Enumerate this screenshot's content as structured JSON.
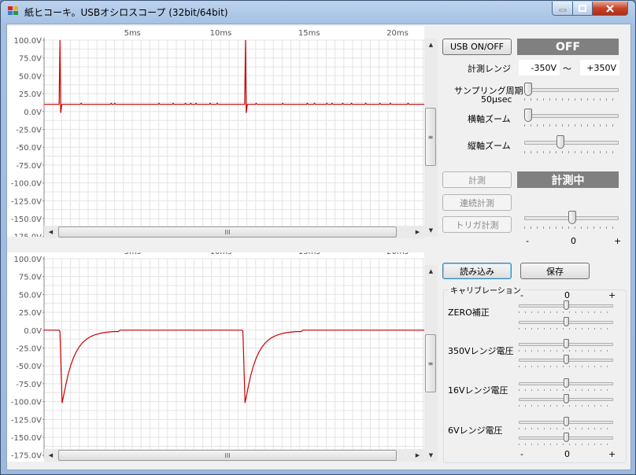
{
  "window": {
    "title": "紙ヒコーキ。USBオシロスコープ (32bit/64bit)"
  },
  "plot": {
    "y_ticks": [
      "100.0V",
      "75.0V",
      "50.0V",
      "25.0V",
      "0.0V",
      "-25.0V",
      "-50.0V",
      "-75.0V",
      "-100.0V",
      "-125.0V",
      "-150.0V",
      "-175.0V"
    ],
    "x_ticks": [
      "5ms",
      "10ms",
      "15ms",
      "20ms"
    ],
    "line_color": "#cc0000"
  },
  "chart_data": [
    {
      "type": "line",
      "x_ticks": [
        "5ms",
        "10ms",
        "15ms",
        "20ms"
      ],
      "ylim": [
        -175,
        100
      ],
      "xlim_ms": [
        0,
        21.5
      ],
      "series": [
        {
          "values_desc": "baseline ~10V with spikes to 100V at ~0.9ms and ~11.4ms"
        }
      ]
    },
    {
      "type": "line",
      "x_ticks": [
        "5ms",
        "10ms",
        "15ms",
        "20ms"
      ],
      "ylim": [
        -175,
        100
      ],
      "xlim_ms": [
        0,
        21.5
      ]
    }
  ],
  "controls": {
    "usb_button": "USB ON/OFF",
    "usb_status": "OFF",
    "range_label": "計測レンジ",
    "range_min": "-350V",
    "range_tilde": "～",
    "range_max": "+350V",
    "sampling_label": "サンプリング周期",
    "sampling_value": "50μsec",
    "hzoom_label": "横軸ズーム",
    "vzoom_label": "縦軸ズーム",
    "measure_button": "計測",
    "measure_status": "計測中",
    "continuous_button": "連続計測",
    "trigger_button": "トリガ計測",
    "trigger_minus": "-",
    "trigger_zero": "0",
    "trigger_plus": "+",
    "load_button": "読み込み",
    "save_button": "保存"
  },
  "calibration": {
    "title": "キャリブレーション",
    "minus": "-",
    "zero": "0",
    "plus": "+",
    "items": [
      "ZERO補正",
      "350Vレンジ電圧",
      "16Vレンジ電圧",
      "6Vレンジ電圧"
    ]
  },
  "scroll": {
    "h_thumb_glyph": "III",
    "v_thumb_glyph": "≡"
  }
}
